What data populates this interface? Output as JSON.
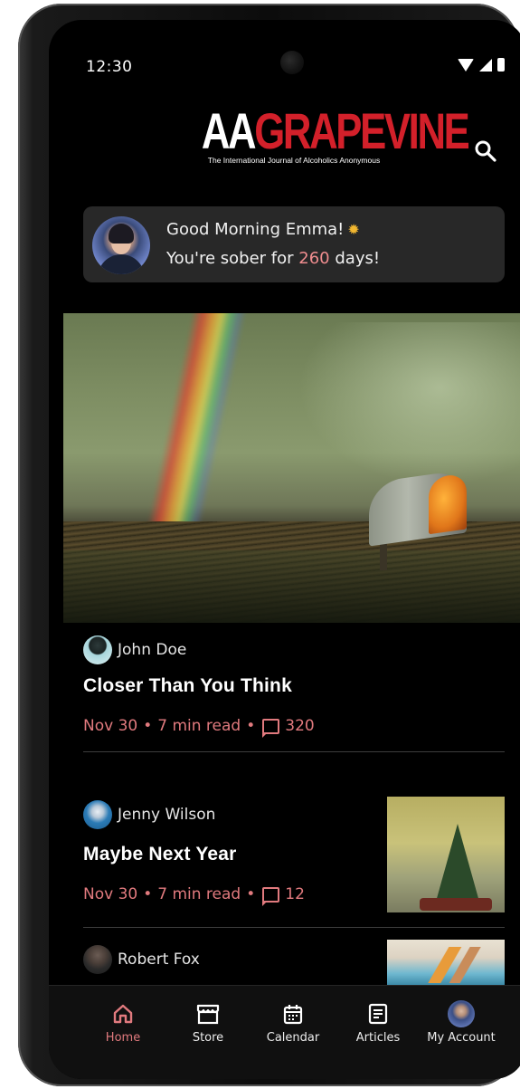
{
  "status_bar": {
    "time": "12:30"
  },
  "header": {
    "logo_part1": "AA",
    "logo_part2": "GRAPEVINE",
    "tagline": "The International Journal of Alcoholics Anonymous",
    "brand_red": "#d3202a"
  },
  "greeting": {
    "line1": "Good Morning Emma!",
    "line2_prefix": "You're sober for",
    "days": "260",
    "line2_suffix": "days!",
    "accent": "#f08d8f"
  },
  "articles": [
    {
      "author": "John Doe",
      "title": "Closer Than You Think",
      "date": "Nov 30",
      "read_time": "7 min read",
      "comments": "320"
    },
    {
      "author": "Jenny Wilson",
      "title": "Maybe Next Year",
      "date": "Nov 30",
      "read_time": "7 min read",
      "comments": "12"
    },
    {
      "author": "Robert Fox"
    }
  ],
  "meta_separator": "•",
  "nav": {
    "items": [
      {
        "label": "Home",
        "icon": "home-icon",
        "active": true
      },
      {
        "label": "Store",
        "icon": "store-icon"
      },
      {
        "label": "Calendar",
        "icon": "calendar-icon"
      },
      {
        "label": "Articles",
        "icon": "articles-icon"
      },
      {
        "label": "My Account",
        "icon": "avatar"
      }
    ],
    "active_color": "#e17a7e"
  }
}
